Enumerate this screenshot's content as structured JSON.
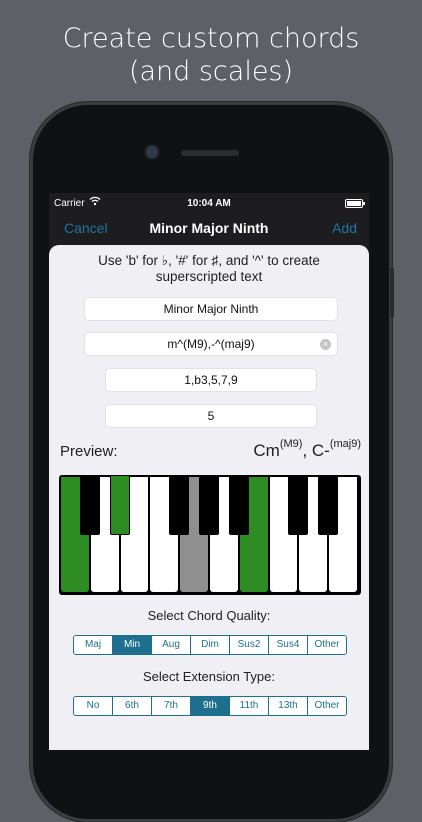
{
  "promo": {
    "line1": "Create custom chords",
    "line2": "(and scales)"
  },
  "status_bar": {
    "carrier": "Carrier",
    "time": "10:04 AM"
  },
  "nav": {
    "cancel_label": "Cancel",
    "title": "Minor Major Ninth",
    "add_label": "Add"
  },
  "form": {
    "instructions": "Use 'b' for ♭, '#' for ♯, and '^' to create superscripted text",
    "name_value": "Minor Major Ninth",
    "symbol_value": "m^(M9),-^(maj9)",
    "intervals_value": "1,b3,5,7,9",
    "count_value": "5"
  },
  "preview": {
    "label": "Preview:",
    "part1_base": "Cm",
    "part1_sup": "(M9)",
    "separator": ", C-",
    "part2_sup": "(maj9)"
  },
  "keyboard": {
    "white_keys_on": [
      0,
      4,
      6
    ],
    "white_keys_root": [
      4
    ],
    "black_keys_on": [
      1
    ]
  },
  "quality": {
    "label": "Select Chord Quality:",
    "options": [
      "Maj",
      "Min",
      "Aug",
      "Dim",
      "Sus2",
      "Sus4",
      "Other"
    ],
    "selected_index": 1
  },
  "extension": {
    "label": "Select Extension Type:",
    "options": [
      "No",
      "6th",
      "7th",
      "9th",
      "11th",
      "13th",
      "Other"
    ],
    "selected_index": 3
  },
  "colors": {
    "accent": "#1e6f8e",
    "key_highlight": "#2e8d22",
    "root_key": "#8f8f8f",
    "background": "#5d6066"
  }
}
